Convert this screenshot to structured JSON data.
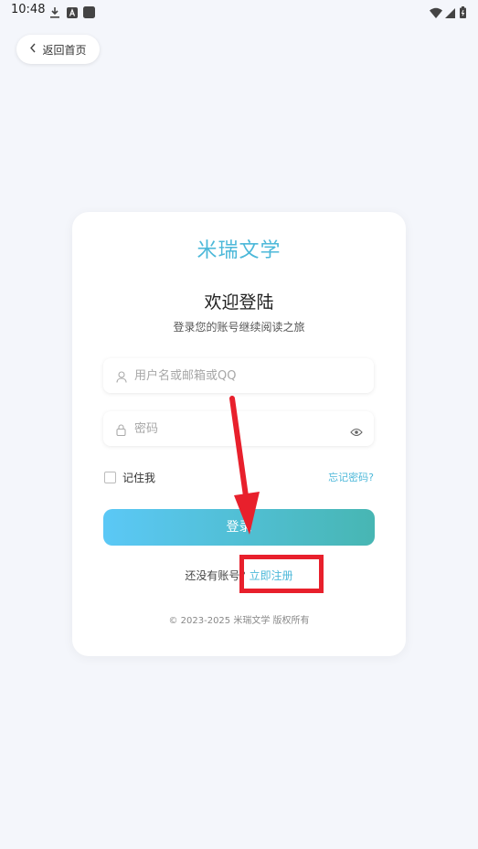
{
  "status_bar": {
    "time": "10:48",
    "icons": [
      "download-icon",
      "a-badge-icon",
      "app-square-icon",
      "wifi-icon",
      "signal-icon",
      "battery-icon"
    ]
  },
  "nav": {
    "back_label": "返回首页"
  },
  "card": {
    "brand": "米瑞文学",
    "title": "欢迎登陆",
    "subtitle": "登录您的账号继续阅读之旅",
    "username_placeholder": "用户名或邮箱或QQ",
    "password_placeholder": "密码",
    "remember_label": "记住我",
    "forgot_label": "忘记密码?",
    "login_label": "登录",
    "no_account_text": "还没有账号?",
    "signup_label": "立即注册",
    "copyright": "© 2023-2025 米瑞文学 版权所有"
  },
  "colors": {
    "accent": "#4cb8d9",
    "gradient_start": "#5bc8f6",
    "gradient_end": "#47b6b3",
    "annotation_red": "#e8202c"
  }
}
